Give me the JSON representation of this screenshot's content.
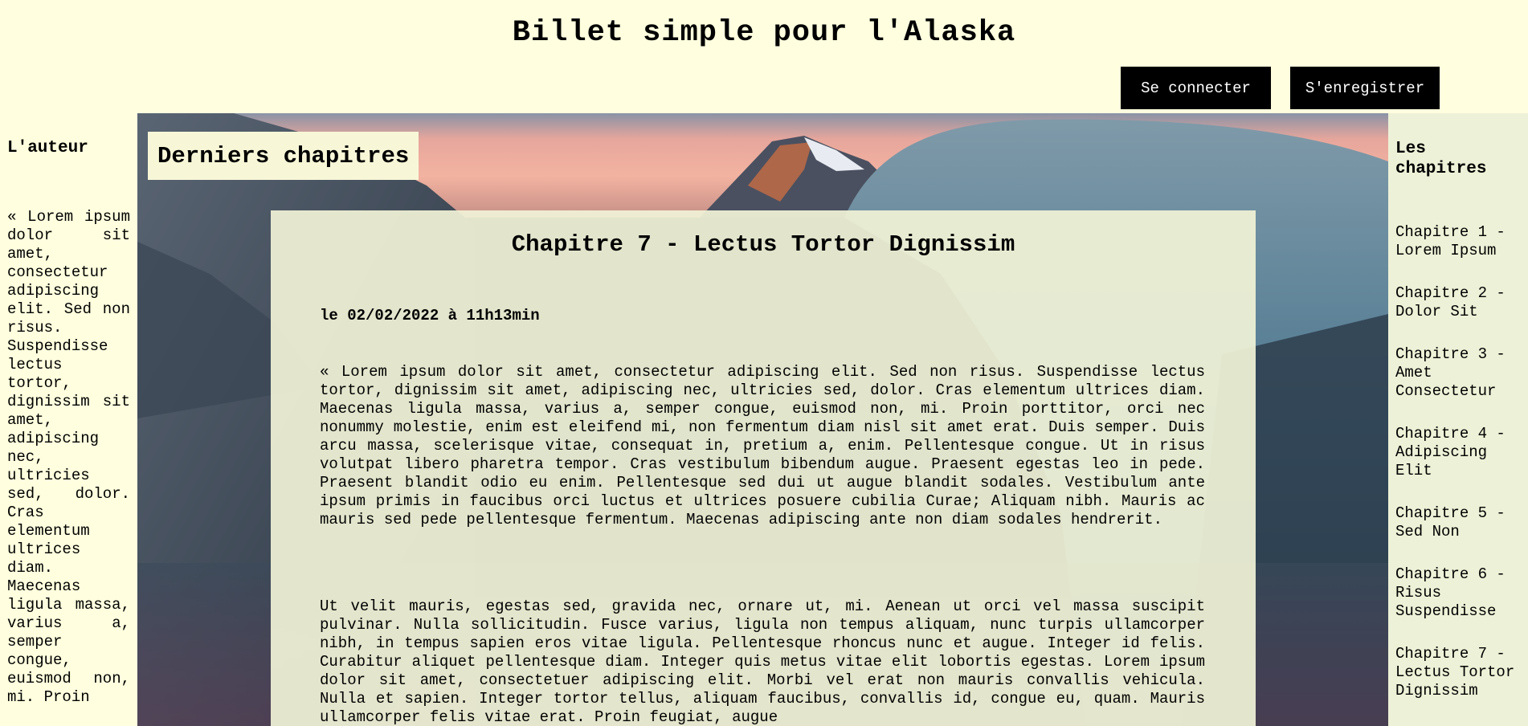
{
  "header": {
    "title": "Billet simple pour l'Alaska",
    "login_label": "Se connecter",
    "register_label": "S'enregistrer"
  },
  "author": {
    "heading": "L'auteur",
    "bio": "« Lorem ipsum dolor sit amet, consectetur adipiscing elit. Sed non risus. Suspendisse lectus tortor, dignissim sit amet, adipiscing nec, ultricies sed, dolor. Cras elementum ultrices diam. Maecenas ligula massa, varius a, semper congue, euismod non, mi. Proin"
  },
  "latest": {
    "heading": "Derniers chapitres",
    "chapter_title": "Chapitre 7 - Lectus Tortor Dignissim",
    "date": "le 02/02/2022 à 11h13min",
    "paragraphs": [
      "« Lorem ipsum dolor sit amet, consectetur adipiscing elit. Sed non risus. Suspendisse lectus tortor, dignissim sit amet, adipiscing nec, ultricies sed, dolor. Cras elementum ultrices diam. Maecenas ligula massa, varius a, semper congue, euismod non, mi. Proin porttitor, orci nec nonummy molestie, enim est eleifend mi, non fermentum diam nisl sit amet erat. Duis semper. Duis arcu massa, scelerisque vitae, consequat in, pretium a, enim. Pellentesque congue. Ut in risus volutpat libero pharetra tempor. Cras vestibulum bibendum augue. Praesent egestas leo in pede. Praesent blandit odio eu enim. Pellentesque sed dui ut augue blandit sodales. Vestibulum ante ipsum primis in faucibus orci luctus et ultrices posuere cubilia Curae; Aliquam nibh. Mauris ac mauris sed pede pellentesque fermentum. Maecenas adipiscing ante non diam sodales hendrerit.",
      "Ut velit mauris, egestas sed, gravida nec, ornare ut, mi. Aenean ut orci vel massa suscipit pulvinar. Nulla sollicitudin. Fusce varius, ligula non tempus aliquam, nunc turpis ullamcorper nibh, in tempus sapien eros vitae ligula. Pellentesque rhoncus nunc et augue. Integer id felis. Curabitur aliquet pellentesque diam. Integer quis metus vitae elit lobortis egestas. Lorem ipsum dolor sit amet, consectetuer adipiscing elit. Morbi vel erat non mauris convallis vehicula. Nulla et sapien. Integer tortor tellus, aliquam faucibus, convallis id, congue eu, quam. Mauris ullamcorper felis vitae erat. Proin feugiat, augue"
    ]
  },
  "chapters": {
    "heading": "Les chapitres",
    "items": [
      "Chapitre 1 - Lorem Ipsum",
      "Chapitre 2 - Dolor Sit",
      "Chapitre 3 - Amet Consectetur",
      "Chapitre 4 - Adipiscing Elit",
      "Chapitre 5 - Sed Non",
      "Chapitre 6 - Risus Suspendisse",
      "Chapitre 7 - Lectus Tortor Dignissim"
    ]
  },
  "colors": {
    "page_background": "#ffffdf",
    "button_background": "#000000",
    "button_text": "#ffffff"
  }
}
